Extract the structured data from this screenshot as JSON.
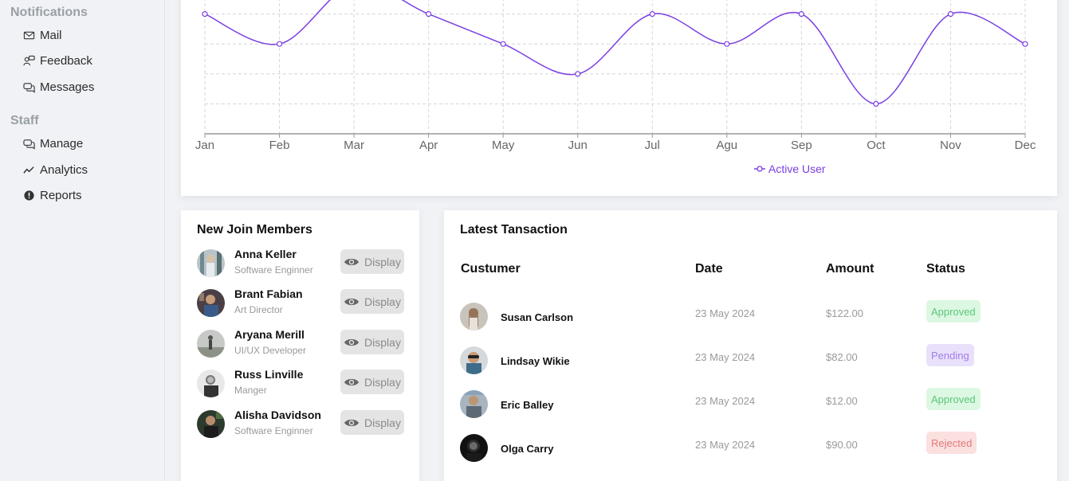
{
  "sidebar": {
    "sections": [
      {
        "title": "Notifications",
        "items": [
          {
            "label": "Mail",
            "icon": "mail-icon"
          },
          {
            "label": "Feedback",
            "icon": "feedback-icon"
          },
          {
            "label": "Messages",
            "icon": "messages-icon"
          }
        ]
      },
      {
        "title": "Staff",
        "items": [
          {
            "label": "Manage",
            "icon": "manage-icon"
          },
          {
            "label": "Analytics",
            "icon": "analytics-icon"
          },
          {
            "label": "Reports",
            "icon": "reports-icon"
          }
        ]
      }
    ]
  },
  "chart_data": {
    "type": "line",
    "categories": [
      "Jan",
      "Feb",
      "Mar",
      "Apr",
      "May",
      "Jun",
      "Jul",
      "Agu",
      "Sep",
      "Oct",
      "Nov",
      "Dec"
    ],
    "series": [
      {
        "name": "Active User",
        "values": [
          4,
          3,
          5,
          4,
          3,
          2,
          4,
          3,
          4,
          1,
          4,
          3
        ],
        "color": "#7a3fe0"
      }
    ],
    "ylim": [
      0,
      4.5
    ],
    "grid": true,
    "legend_position": "bottom-center"
  },
  "members": {
    "title": "New Join Members",
    "button_label": "Display",
    "list": [
      {
        "name": "Anna Keller",
        "role": "Software Enginner"
      },
      {
        "name": "Brant Fabian",
        "role": "Art Director"
      },
      {
        "name": "Aryana Merill",
        "role": "UI/UX Developer"
      },
      {
        "name": "Russ Linville",
        "role": "Manger"
      },
      {
        "name": "Alisha Davidson",
        "role": "Software Enginner"
      }
    ]
  },
  "transactions": {
    "title": "Latest Tansaction",
    "headers": {
      "customer": "Custumer",
      "date": "Date",
      "amount": "Amount",
      "status": "Status"
    },
    "rows": [
      {
        "customer": "Susan Carlson",
        "date": "23 May 2024",
        "amount": "$122.00",
        "status": "Approved"
      },
      {
        "customer": "Lindsay Wikie",
        "date": "23 May 2024",
        "amount": "$82.00",
        "status": "Pending"
      },
      {
        "customer": "Eric Balley",
        "date": "23 May 2024",
        "amount": "$12.00",
        "status": "Approved"
      },
      {
        "customer": "Olga Carry",
        "date": "23 May 2024",
        "amount": "$90.00",
        "status": "Rejected"
      }
    ]
  }
}
